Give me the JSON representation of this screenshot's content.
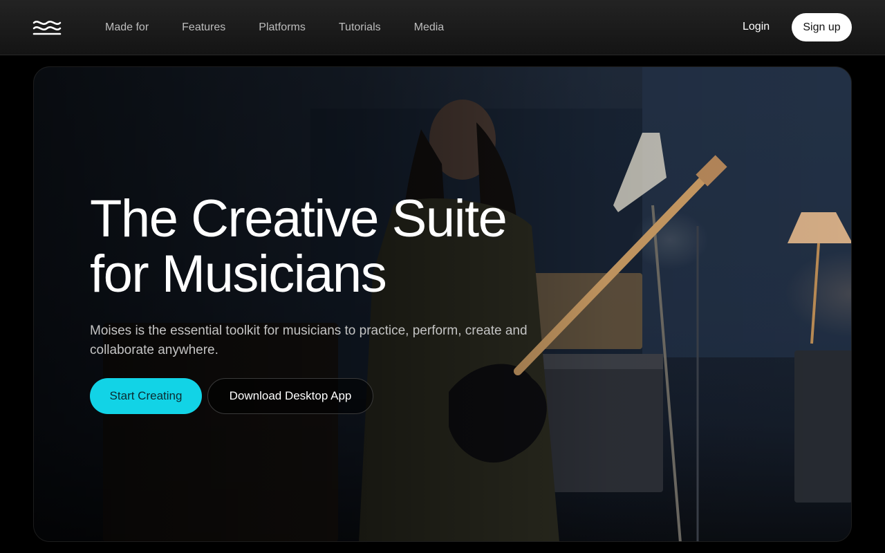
{
  "header": {
    "logo": "moises-wave-logo",
    "nav": [
      "Made for",
      "Features",
      "Platforms",
      "Tutorials",
      "Media"
    ],
    "login_label": "Login",
    "signup_label": "Sign up"
  },
  "hero": {
    "headline_line1": "The Creative Suite",
    "headline_line2": "for Musicians",
    "subtext": "Moises is the essential toolkit for musicians to practice, perform, create and collaborate anywhere.",
    "primary_cta": "Start Creating",
    "secondary_cta": "Download Desktop App",
    "background_image": "guitarist-in-studio-photo"
  },
  "colors": {
    "accent": "#12d3e6",
    "page_background": "#000000",
    "nav_text": "#bdbdbd"
  }
}
